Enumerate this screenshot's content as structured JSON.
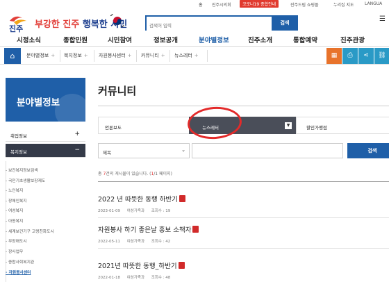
{
  "utility": {
    "items": [
      "홈",
      "진주시의회",
      "코로나19 종합안내",
      "진주드림 쇼핑몰",
      "누리집 지도",
      "LANGUA"
    ]
  },
  "header": {
    "slogan_a": "부강한 진주",
    "slogan_b": "행복한 시민",
    "search_placeholder": "검색어 입력",
    "search_button": "검색"
  },
  "gnb": {
    "items": [
      "시정소식",
      "종합민원",
      "시민참여",
      "정보공개",
      "분야별정보",
      "진주소개",
      "통합예약",
      "진주관광"
    ]
  },
  "breadcrumb": {
    "items": [
      "분야별정보",
      "복지정보",
      "자원봉사센터",
      "커뮤니티",
      "뉴스레터"
    ]
  },
  "sidebar": {
    "title": "분야별정보",
    "items": [
      {
        "label": "취업정보",
        "symbol": "+"
      },
      {
        "label": "복지정보",
        "symbol": "−"
      }
    ],
    "sub_items": [
      "보건복지정보검색",
      "국민기초생활보장제도",
      "노인복지",
      "장애인복지",
      "여성복지",
      "아동복지",
      "세계보건기구 고령친화도시",
      "무장애도시",
      "장사업무",
      "종합사회복지관",
      "자원봉사센터"
    ]
  },
  "main": {
    "title": "커뮤니티",
    "categories": [
      "언론보도",
      "뉴스레터",
      "할인가맹점"
    ],
    "search_select": "제목",
    "search_button": "검색",
    "count_prefix": "총 ",
    "count_num": "7",
    "count_suffix": "건의 게시물이 있습니다. (",
    "page_num": "1",
    "page_suffix": "/1 페이지)",
    "posts": [
      {
        "title": "2022 년 따뜻한 동행 하반기",
        "date": "2023-01-09",
        "dept": "여성가족과",
        "views": "조회수 : 19"
      },
      {
        "title": "자원봉사 하기 좋은날 홍보 소책자",
        "date": "2022-05-11",
        "dept": "여성가족과",
        "views": "조회수 : 42"
      },
      {
        "title": "2021년 따뜻한 동행_하반기",
        "date": "2022-01-18",
        "dept": "여성가족과",
        "views": "조회수 : 48"
      }
    ]
  },
  "colors": {
    "brand_blue": "#1f5fa8",
    "accent_red": "#e32a2a",
    "dark_active": "#343a48"
  }
}
